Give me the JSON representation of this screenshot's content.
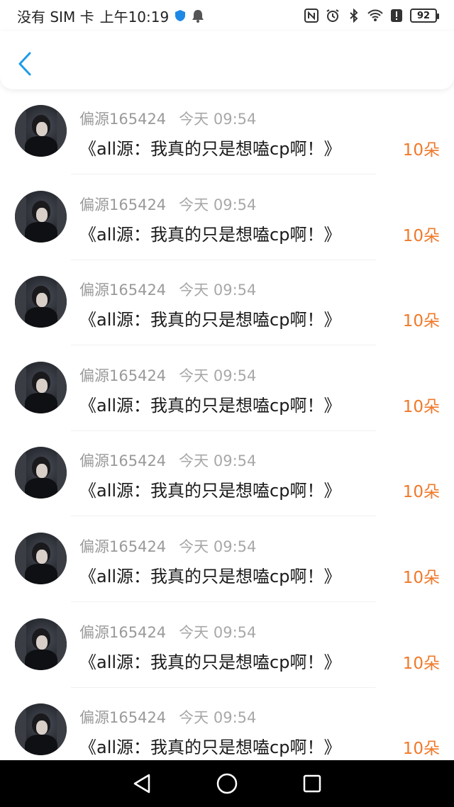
{
  "status_bar": {
    "carrier": "没有 SIM 卡",
    "time": "上午10:19",
    "battery": "92",
    "icons": [
      "shield-icon",
      "bell-icon",
      "nfc-icon",
      "alarm-icon",
      "bluetooth-icon",
      "wifi-icon",
      "alert-icon",
      "battery-icon"
    ]
  },
  "header": {
    "back_icon": "chevron-left-icon",
    "accent_color": "#1e9be8"
  },
  "records": [
    {
      "user": "偏源165424",
      "time": "今天 09:54",
      "title": "《all源：我真的只是想嗑cp啊！》",
      "amount": "10朵"
    },
    {
      "user": "偏源165424",
      "time": "今天 09:54",
      "title": "《all源：我真的只是想嗑cp啊！》",
      "amount": "10朵"
    },
    {
      "user": "偏源165424",
      "time": "今天 09:54",
      "title": "《all源：我真的只是想嗑cp啊！》",
      "amount": "10朵"
    },
    {
      "user": "偏源165424",
      "time": "今天 09:54",
      "title": "《all源：我真的只是想嗑cp啊！》",
      "amount": "10朵"
    },
    {
      "user": "偏源165424",
      "time": "今天 09:54",
      "title": "《all源：我真的只是想嗑cp啊！》",
      "amount": "10朵"
    },
    {
      "user": "偏源165424",
      "time": "今天 09:54",
      "title": "《all源：我真的只是想嗑cp啊！》",
      "amount": "10朵"
    },
    {
      "user": "偏源165424",
      "time": "今天 09:54",
      "title": "《all源：我真的只是想嗑cp啊！》",
      "amount": "10朵"
    },
    {
      "user": "偏源165424",
      "time": "今天 09:54",
      "title": "《all源：我真的只是想嗑cp啊！》",
      "amount": "10朵"
    }
  ],
  "colors": {
    "amount": "#f0792a",
    "meta": "#9a9a9a"
  },
  "system_nav": {
    "icons": [
      "back-triangle-icon",
      "home-circle-icon",
      "recents-square-icon"
    ]
  }
}
